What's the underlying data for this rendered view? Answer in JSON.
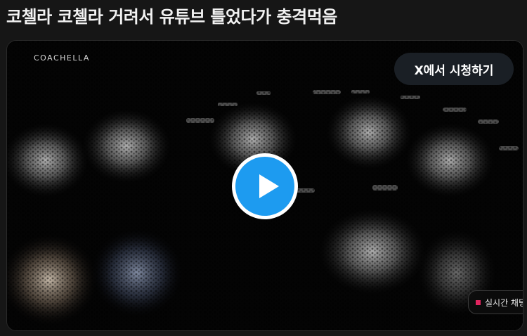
{
  "post": {
    "title": "코첼라 코첼라 거려서 유튜브 틀었다가 충격먹음"
  },
  "video": {
    "watermark": "COACHELLA",
    "watch_on_x_label": "X에서 시청하기",
    "live_chat_label": "실시간 채팅",
    "play_icon": "play-icon",
    "accent_color": "#1d9bf0"
  }
}
